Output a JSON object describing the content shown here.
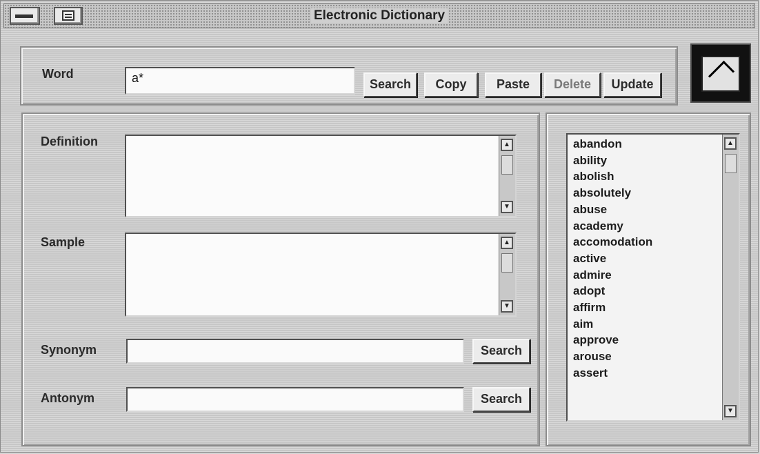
{
  "window": {
    "title": "Electronic Dictionary"
  },
  "toolbar": {
    "word_label": "Word",
    "word_value": "a*",
    "search_label": "Search",
    "copy_label": "Copy",
    "paste_label": "Paste",
    "delete_label": "Delete",
    "update_label": "Update"
  },
  "fields": {
    "definition_label": "Definition",
    "sample_label": "Sample",
    "synonym_label": "Synonym",
    "synonym_search_label": "Search",
    "antonym_label": "Antonym",
    "antonym_search_label": "Search"
  },
  "word_list": {
    "items": [
      "abandon",
      "ability",
      "abolish",
      "absolutely",
      "abuse",
      "academy",
      "accomodation",
      "active",
      "admire",
      "adopt",
      "affirm",
      "aim",
      "approve",
      "arouse",
      "assert"
    ]
  },
  "icons": {
    "system_menu": "minus-icon",
    "window_menu": "list-icon",
    "scroll_up": "up-arrow-icon",
    "scroll_down": "down-arrow-icon",
    "logo": "app-logo-icon"
  }
}
